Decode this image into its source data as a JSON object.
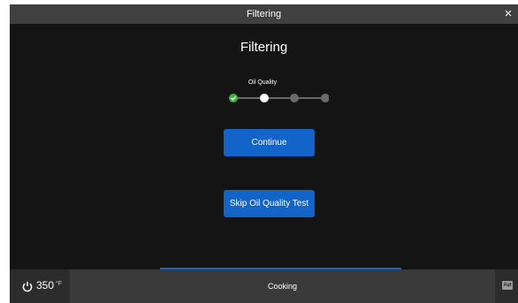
{
  "titlebar": {
    "title": "Filtering",
    "close_label": "×"
  },
  "heading": "Filtering",
  "stepper": {
    "current_label": "Oil Quality",
    "current_index": 1,
    "step_count": 4,
    "colors": {
      "done": "#3cb043",
      "current": "#ffffff",
      "pending": "#6a6a6a",
      "line": "#bbbbbb"
    }
  },
  "buttons": {
    "continue": "Continue",
    "skip": "Skip Oil Quality Test"
  },
  "footer": {
    "temperature": "350",
    "unit": "°F",
    "mode": "Cooking",
    "keyboard_label": "A⇄"
  },
  "colors": {
    "accent": "#1264c8",
    "background": "#141414"
  }
}
